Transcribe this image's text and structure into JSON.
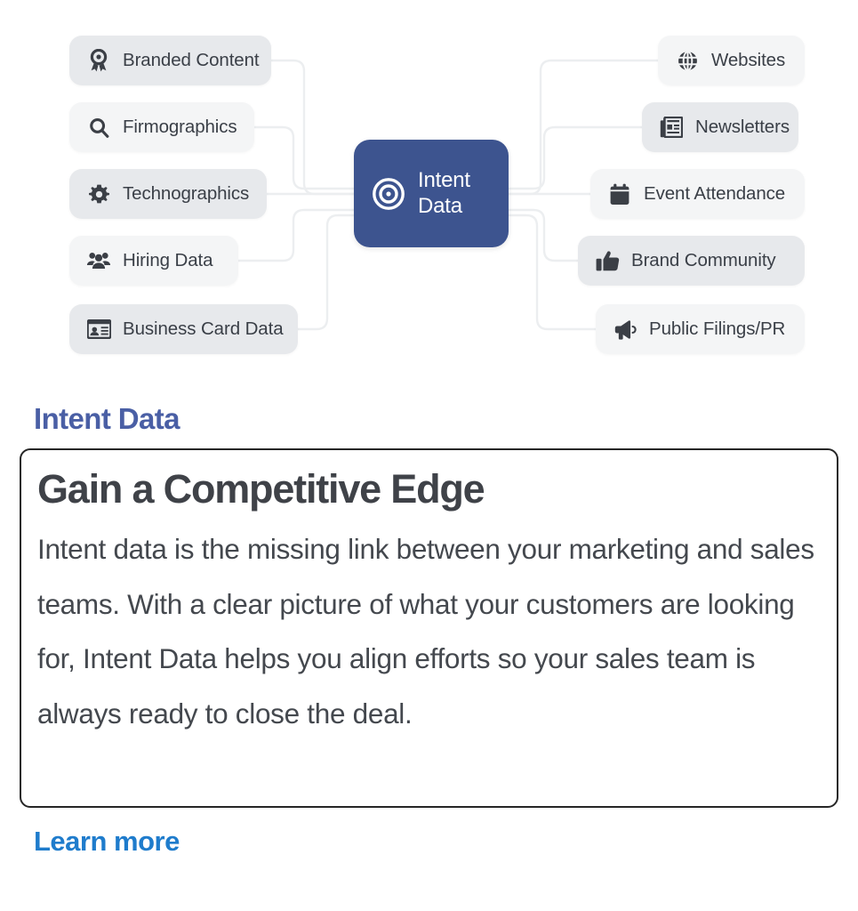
{
  "diagram": {
    "center": {
      "label_line1": "Intent",
      "label_line2": "Data",
      "icon": "target-bullseye-icon",
      "color": "#3d548f"
    },
    "left_nodes": [
      {
        "label": "Branded Content",
        "icon": "award-ribbon-icon",
        "tone": "tone-a"
      },
      {
        "label": "Firmographics",
        "icon": "search-icon",
        "tone": "tone-b"
      },
      {
        "label": "Technographics",
        "icon": "gear-icon",
        "tone": "tone-a"
      },
      {
        "label": "Hiring Data",
        "icon": "people-group-icon",
        "tone": "tone-b"
      },
      {
        "label": "Business Card Data",
        "icon": "id-card-icon",
        "tone": "tone-a"
      }
    ],
    "right_nodes": [
      {
        "label": "Websites",
        "icon": "globe-icon",
        "tone": "tone-b"
      },
      {
        "label": "Newsletters",
        "icon": "newspaper-icon",
        "tone": "tone-a"
      },
      {
        "label": "Event Attendance",
        "icon": "calendar-icon",
        "tone": "tone-b"
      },
      {
        "label": "Brand Community",
        "icon": "thumbs-up-icon",
        "tone": "tone-a"
      },
      {
        "label": "Public Filings/PR",
        "icon": "megaphone-icon",
        "tone": "tone-b"
      }
    ],
    "connector_color": "#eceef0"
  },
  "content": {
    "eyebrow": "Intent Data",
    "eyebrow_color": "#4a5fa5",
    "card_title": "Gain a Competitive Edge",
    "card_body": "Intent data is the missing link between your marketing and sales teams. With a clear picture of what your customers are looking for, Intent Data helps you align efforts so your sales team is always ready to close the deal.",
    "learn_more": "Learn more",
    "learn_more_color": "#1f7ccc"
  }
}
